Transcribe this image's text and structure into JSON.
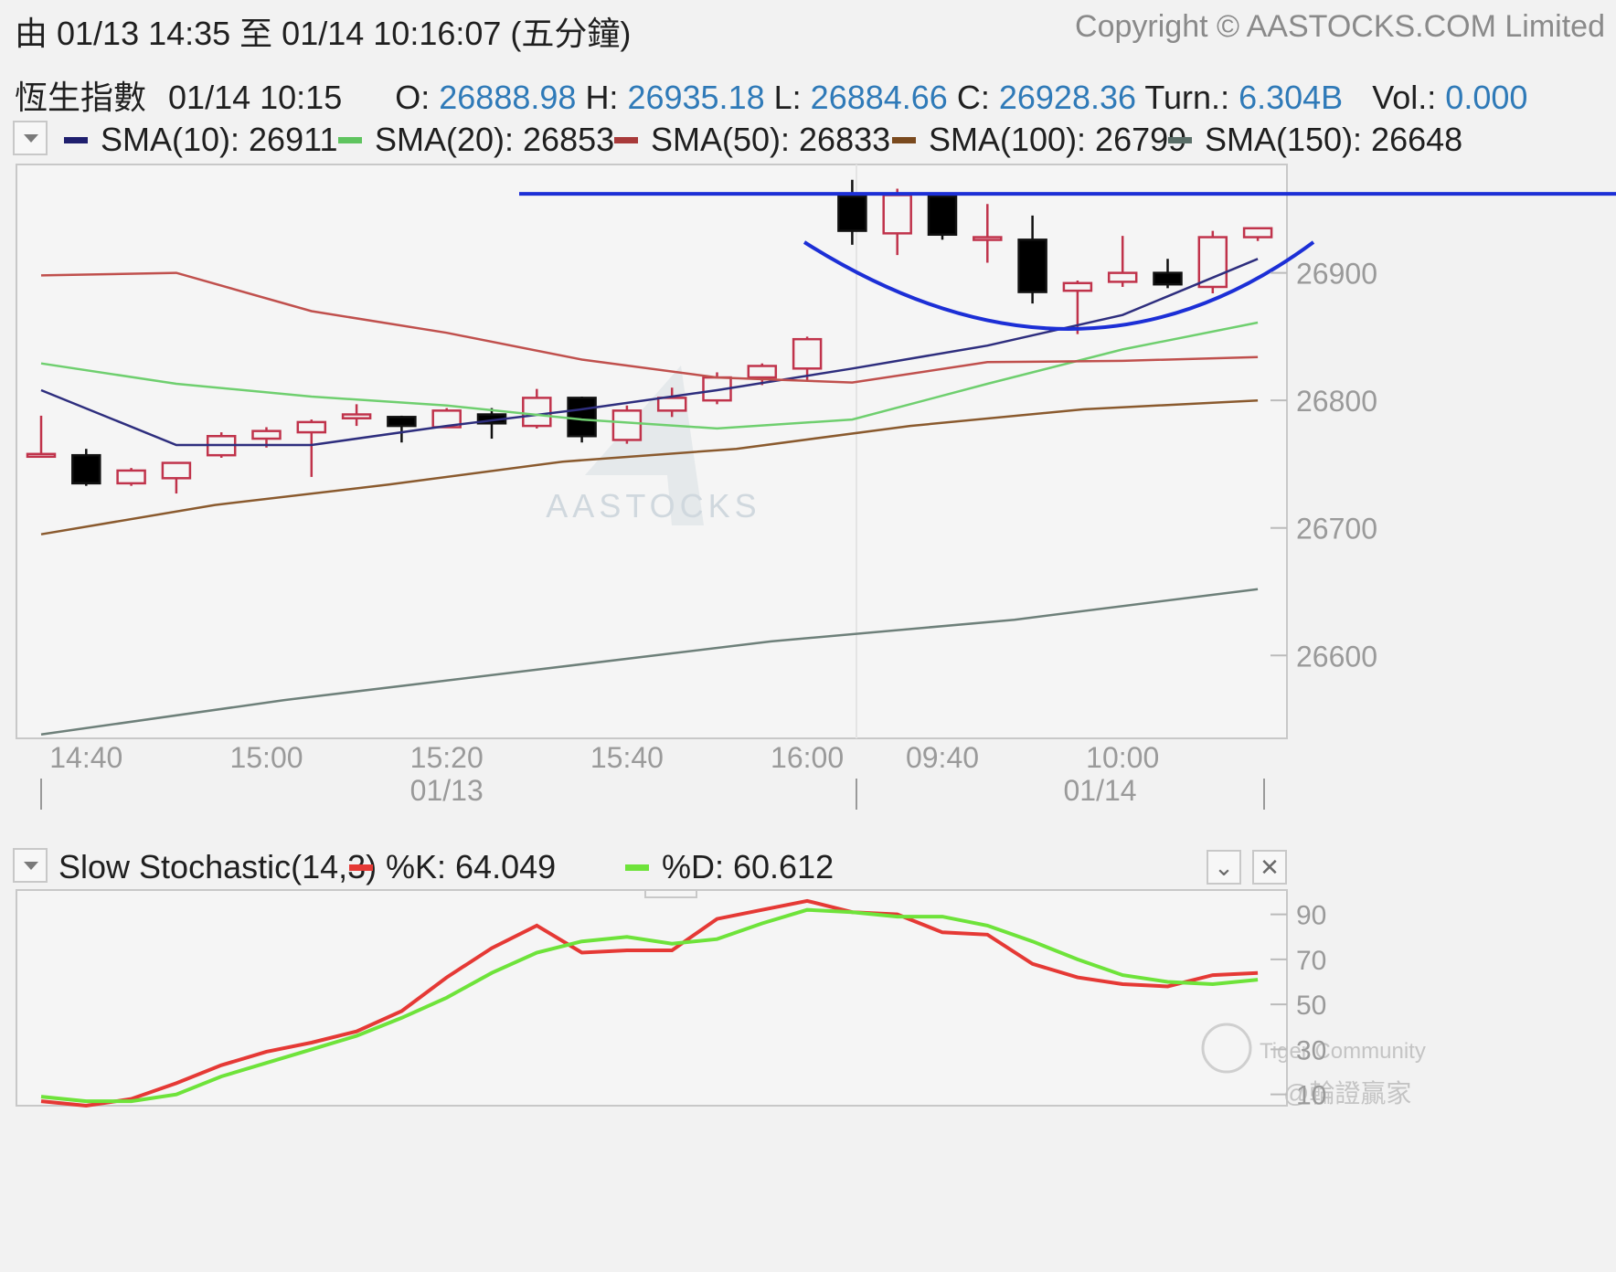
{
  "header": {
    "range_label": "由  01/13 14:35 至  01/14 10:16:07 (五分鐘)",
    "copyright": "Copyright © AASTOCKS.COM Limited"
  },
  "quote": {
    "name": "恆生指數",
    "time": "01/14 10:15",
    "open_label": "O:",
    "open": "26888.98",
    "high_label": "H:",
    "high": "26935.18",
    "low_label": "L:",
    "low": "26884.66",
    "close_label": "C:",
    "close": "26928.36",
    "turnover_label": "Turn.:",
    "turnover": "6.304B",
    "volume_label": "Vol.:",
    "volume": "0.000"
  },
  "sma_legend": [
    {
      "label": "SMA(10): 26911",
      "color": "#1f1f6e"
    },
    {
      "label": "SMA(20): 26853",
      "color": "#5fc45f"
    },
    {
      "label": "SMA(50): 26833",
      "color": "#a83a3a"
    },
    {
      "label": "SMA(100): 26799",
      "color": "#7a4a1e"
    },
    {
      "label": "SMA(150): 26648",
      "color": "#5a6e68"
    }
  ],
  "watermark": {
    "logo_text": "AASTOCKS",
    "tiger": "Tiger Community",
    "handle": "@輪證贏家"
  },
  "chart_data": [
    {
      "type": "candlestick",
      "y_ticks": [
        26900,
        26800,
        26700,
        26600
      ],
      "ylim": [
        26535,
        26985
      ],
      "x_tick_labels": [
        "14:40",
        "15:00",
        "15:20",
        "15:40",
        "16:00",
        "09:40",
        "10:00"
      ],
      "date_labels": [
        "01/13",
        "01/14"
      ],
      "candles": [
        {
          "t": "14:35",
          "o": 26758,
          "h": 26788,
          "l": 26757,
          "c": 26758
        },
        {
          "t": "14:40",
          "o": 26757,
          "h": 26762,
          "l": 26733,
          "c": 26735
        },
        {
          "t": "14:45",
          "o": 26735,
          "h": 26747,
          "l": 26733,
          "c": 26745
        },
        {
          "t": "14:50",
          "o": 26739,
          "h": 26751,
          "l": 26727,
          "c": 26751
        },
        {
          "t": "14:55",
          "o": 26757,
          "h": 26775,
          "l": 26755,
          "c": 26772
        },
        {
          "t": "15:00",
          "o": 26770,
          "h": 26779,
          "l": 26763,
          "c": 26776
        },
        {
          "t": "15:05",
          "o": 26775,
          "h": 26785,
          "l": 26740,
          "c": 26783
        },
        {
          "t": "15:10",
          "o": 26786,
          "h": 26797,
          "l": 26780,
          "c": 26789
        },
        {
          "t": "15:15",
          "o": 26787,
          "h": 26788,
          "l": 26767,
          "c": 26780
        },
        {
          "t": "15:20",
          "o": 26779,
          "h": 26794,
          "l": 26779,
          "c": 26792
        },
        {
          "t": "15:25",
          "o": 26789,
          "h": 26794,
          "l": 26770,
          "c": 26782
        },
        {
          "t": "15:30",
          "o": 26780,
          "h": 26809,
          "l": 26778,
          "c": 26802
        },
        {
          "t": "15:35",
          "o": 26802,
          "h": 26803,
          "l": 26767,
          "c": 26772
        },
        {
          "t": "15:40",
          "o": 26769,
          "h": 26796,
          "l": 26766,
          "c": 26792
        },
        {
          "t": "15:45",
          "o": 26792,
          "h": 26810,
          "l": 26787,
          "c": 26802
        },
        {
          "t": "15:50",
          "o": 26800,
          "h": 26822,
          "l": 26797,
          "c": 26818
        },
        {
          "t": "15:55",
          "o": 26818,
          "h": 26829,
          "l": 26812,
          "c": 26827
        },
        {
          "t": "16:00",
          "o": 26825,
          "h": 26850,
          "l": 26815,
          "c": 26848
        },
        {
          "t": "09:30",
          "o": 26960,
          "h": 26973,
          "l": 26922,
          "c": 26933
        },
        {
          "t": "09:35",
          "o": 26931,
          "h": 26966,
          "l": 26914,
          "c": 26961
        },
        {
          "t": "09:40",
          "o": 26960,
          "h": 26962,
          "l": 26926,
          "c": 26930
        },
        {
          "t": "09:45",
          "o": 26928,
          "h": 26954,
          "l": 26908,
          "c": 26928
        },
        {
          "t": "09:50",
          "o": 26926,
          "h": 26945,
          "l": 26876,
          "c": 26885
        },
        {
          "t": "09:55",
          "o": 26886,
          "h": 26894,
          "l": 26852,
          "c": 26892
        },
        {
          "t": "10:00",
          "o": 26893,
          "h": 26929,
          "l": 26889,
          "c": 26900
        },
        {
          "t": "10:05",
          "o": 26900,
          "h": 26911,
          "l": 26888,
          "c": 26891
        },
        {
          "t": "10:10",
          "o": 26889,
          "h": 26933,
          "l": 26884,
          "c": 26928
        },
        {
          "t": "10:15",
          "o": 26928,
          "h": 26935,
          "l": 26925,
          "c": 26935
        }
      ],
      "sma_series": [
        {
          "name": "SMA(10)",
          "color": "#2e2e7e",
          "values": [
            26808,
            26765,
            26765,
            26780,
            26793,
            26808,
            26825,
            26843,
            26867,
            26911
          ]
        },
        {
          "name": "SMA(20)",
          "color": "#6fcf6f",
          "values": [
            26829,
            26813,
            26803,
            26796,
            26785,
            26778,
            26785,
            26813,
            26840,
            26861
          ]
        },
        {
          "name": "SMA(50)",
          "color": "#c0504d",
          "values": [
            26898,
            26900,
            26870,
            26853,
            26832,
            26818,
            26814,
            26830,
            26831,
            26834
          ]
        },
        {
          "name": "SMA(100)",
          "color": "#8a5a2e",
          "values": [
            26695,
            26718,
            26734,
            26752,
            26762,
            26780,
            26793,
            26800
          ]
        },
        {
          "name": "SMA(150)",
          "color": "#6e807a",
          "values": [
            26538,
            26565,
            26588,
            26611,
            26628,
            26652
          ]
        }
      ],
      "annotations": {
        "resistance_level": 26962,
        "cup_curve": true,
        "color": "#1c2fd6"
      }
    },
    {
      "type": "line",
      "title": "Slow Stochastic(14,3)",
      "ylim": [
        5,
        100
      ],
      "y_ticks": [
        90,
        70,
        50,
        30,
        10
      ],
      "series": [
        {
          "name": "%K: 64.049",
          "color": "#e53935",
          "values": [
            7,
            5,
            8,
            15,
            23,
            29,
            33,
            38,
            47,
            62,
            75,
            85,
            73,
            74,
            74,
            88,
            92,
            96,
            91,
            90,
            82,
            81,
            68,
            62,
            59,
            58,
            63,
            64
          ]
        },
        {
          "name": "%D: 60.612",
          "color": "#6ee33a",
          "values": [
            9,
            7,
            7,
            10,
            18,
            24,
            30,
            36,
            44,
            53,
            64,
            73,
            78,
            80,
            77,
            79,
            86,
            92,
            91,
            89,
            89,
            85,
            78,
            70,
            63,
            60,
            59,
            61
          ]
        }
      ]
    }
  ]
}
